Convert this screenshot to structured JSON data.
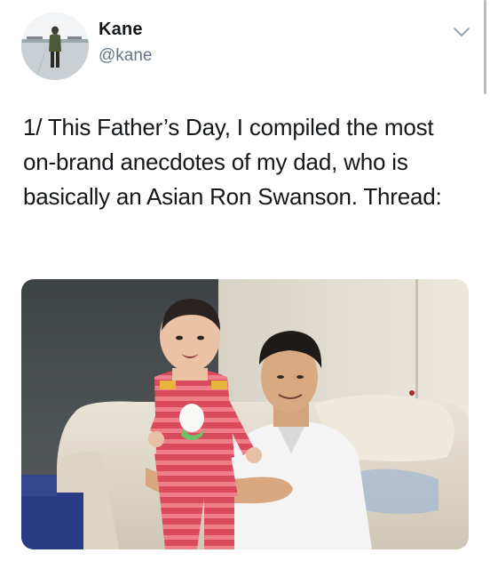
{
  "user": {
    "display_name": "Kane",
    "handle": "@kane",
    "avatar_icon": "profile-photo-person-standing"
  },
  "menu": {
    "icon": "chevron-down-icon"
  },
  "tweet": {
    "text": "1/ This Father’s Day, I compiled the most on-brand anecdotes of my dad, who is basically an Asian Ron Swanson. Thread:"
  },
  "media": {
    "icon": "photo-father-holding-baby"
  },
  "colors": {
    "name": "#14171a",
    "handle": "#657786",
    "chevron": "#657786"
  }
}
